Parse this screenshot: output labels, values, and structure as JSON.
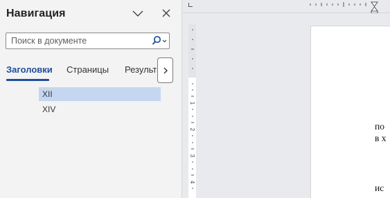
{
  "nav": {
    "title": "Навигация",
    "search_placeholder": "Поиск в документе",
    "tabs": [
      "Заголовки",
      "Страницы",
      "Результа"
    ],
    "headings": [
      "XII",
      "XIV"
    ]
  },
  "document": {
    "lines": [
      "по",
      "в х",
      "ис"
    ]
  },
  "ruler": {
    "side_numbers": [
      "1",
      "2",
      "3",
      "4"
    ]
  },
  "colors": {
    "accent": "#1f4e99",
    "selected": "#c5d7f0"
  },
  "icons": {
    "collapse": "chevron-down-icon",
    "close": "close-icon",
    "search": "search-icon",
    "more_tabs": "chevron-right-icon"
  }
}
